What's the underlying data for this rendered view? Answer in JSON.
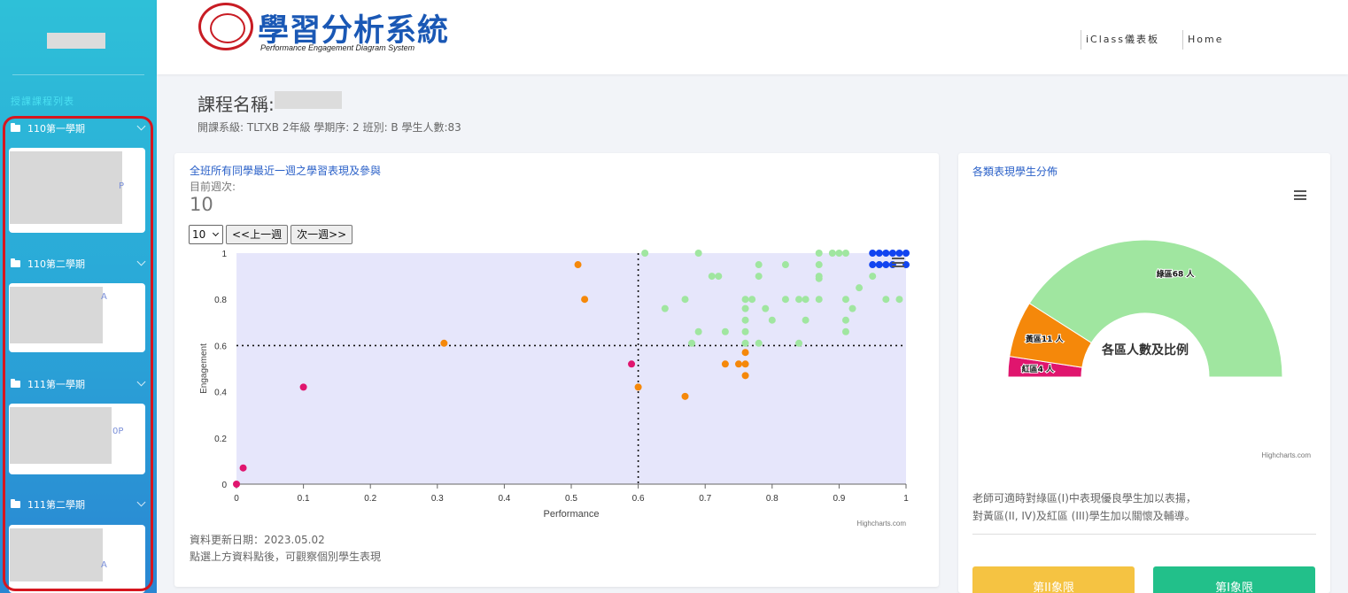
{
  "sidebar": {
    "section_title": "授課課程列表",
    "terms": [
      {
        "label": "110第一學期"
      },
      {
        "label": "110第二學期"
      },
      {
        "label": "111第一學期"
      },
      {
        "label": "111第二學期"
      }
    ],
    "card_fragments": [
      "P",
      "A",
      "0P",
      "A"
    ]
  },
  "header": {
    "logo_title": "學習分析系統",
    "logo_subtitle": "Performance Engagement Diagram System",
    "nav": [
      {
        "label": "iClass儀表板"
      },
      {
        "label": "Home"
      }
    ]
  },
  "course": {
    "name_label": "課程名稱:",
    "meta": "開課系級: TLTXB 2年級 學期序: 2 班別: B 學生人數:83"
  },
  "left_panel": {
    "title": "全班所有同學最近一週之學習表現及參與",
    "week_label": "目前週次:",
    "week_value": "10",
    "week_select": "10",
    "prev_button": "<<上一週",
    "next_button": "次一週>>",
    "updated": "資料更新日期：2023.05.02",
    "click_hint": "點選上方資料點後，可觀察個別學生表現",
    "credit": "Highcharts.com"
  },
  "right_panel": {
    "title": "各類表現學生分佈",
    "credit": "Highcharts.com",
    "hint_line1": "老師可適時對綠區(I)中表現優良學生加以表揚，",
    "hint_line2": "對黃區(II, IV)及紅區 (III)學生加以關懷及輔導。",
    "btn_quad2": "第II象限",
    "btn_quad1": "第I象限",
    "quad2_color": "#f5c342",
    "quad1_color": "#22c08a"
  },
  "chart_data": [
    {
      "type": "scatter",
      "xlabel": "Performance",
      "ylabel": "Engagement",
      "xlim": [
        0,
        1
      ],
      "ylim": [
        0,
        1
      ],
      "xticks": [
        "0",
        "0.1",
        "0.2",
        "0.3",
        "0.4",
        "0.5",
        "0.6",
        "0.7",
        "0.8",
        "0.9",
        "1"
      ],
      "yticks": [
        "0",
        "0.2",
        "0.4",
        "0.6",
        "0.8",
        "1"
      ],
      "thresholds": {
        "x": 0.6,
        "y": 0.6
      },
      "colors": {
        "red": "#e0156e",
        "orange": "#f5880a",
        "green": "#a0e6a0",
        "blue": "#1244f0"
      },
      "series": [
        {
          "color_key": "red",
          "points": [
            [
              0,
              0
            ],
            [
              0.01,
              0.07
            ],
            [
              0.1,
              0.42
            ],
            [
              0.59,
              0.52
            ]
          ]
        },
        {
          "color_key": "orange",
          "points": [
            [
              0.31,
              0.61
            ],
            [
              0.51,
              0.95
            ],
            [
              0.52,
              0.8
            ],
            [
              0.6,
              0.42
            ],
            [
              0.67,
              0.38
            ],
            [
              0.73,
              0.52
            ],
            [
              0.75,
              0.52
            ],
            [
              0.76,
              0.52
            ],
            [
              0.76,
              0.57
            ],
            [
              0.76,
              0.47
            ]
          ]
        },
        {
          "color_key": "green",
          "points": [
            [
              0.61,
              1
            ],
            [
              0.64,
              0.76
            ],
            [
              0.67,
              0.8
            ],
            [
              0.68,
              0.61
            ],
            [
              0.69,
              1
            ],
            [
              0.69,
              0.66
            ],
            [
              0.71,
              0.9
            ],
            [
              0.72,
              0.9
            ],
            [
              0.73,
              0.66
            ],
            [
              0.76,
              0.8
            ],
            [
              0.76,
              0.76
            ],
            [
              0.76,
              0.71
            ],
            [
              0.76,
              0.66
            ],
            [
              0.76,
              0.61
            ],
            [
              0.77,
              0.8
            ],
            [
              0.78,
              0.95
            ],
            [
              0.78,
              0.9
            ],
            [
              0.78,
              0.61
            ],
            [
              0.79,
              0.76
            ],
            [
              0.8,
              0.71
            ],
            [
              0.82,
              0.95
            ],
            [
              0.82,
              0.8
            ],
            [
              0.84,
              0.8
            ],
            [
              0.84,
              0.61
            ],
            [
              0.85,
              0.8
            ],
            [
              0.85,
              0.71
            ],
            [
              0.87,
              1
            ],
            [
              0.87,
              0.95
            ],
            [
              0.87,
              0.9
            ],
            [
              0.87,
              0.89
            ],
            [
              0.87,
              0.8
            ],
            [
              0.89,
              1
            ],
            [
              0.9,
              1
            ],
            [
              0.91,
              1
            ],
            [
              0.91,
              0.8
            ],
            [
              0.91,
              0.71
            ],
            [
              0.91,
              0.66
            ],
            [
              0.92,
              0.76
            ],
            [
              0.93,
              0.85
            ],
            [
              0.95,
              0.9
            ],
            [
              0.96,
              0.95
            ],
            [
              0.97,
              0.8
            ],
            [
              0.99,
              0.8
            ]
          ]
        },
        {
          "color_key": "blue",
          "points": [
            [
              0.95,
              1
            ],
            [
              0.96,
              1
            ],
            [
              0.97,
              1
            ],
            [
              0.98,
              1
            ],
            [
              0.99,
              1
            ],
            [
              1,
              1
            ],
            [
              0.95,
              0.95
            ],
            [
              0.96,
              0.95
            ],
            [
              0.97,
              0.95
            ],
            [
              0.98,
              0.95
            ],
            [
              1,
              0.95
            ]
          ]
        }
      ]
    },
    {
      "type": "pie",
      "variant": "semi-donut",
      "center_title": "各區人數及比例",
      "slices": [
        {
          "label": "紅區4 人",
          "value": 4,
          "color": "#e0156e"
        },
        {
          "label": "黃區11 人",
          "value": 11,
          "color": "#f5880a"
        },
        {
          "label": "綠區68 人",
          "value": 68,
          "color": "#a0e6a0"
        }
      ]
    }
  ]
}
